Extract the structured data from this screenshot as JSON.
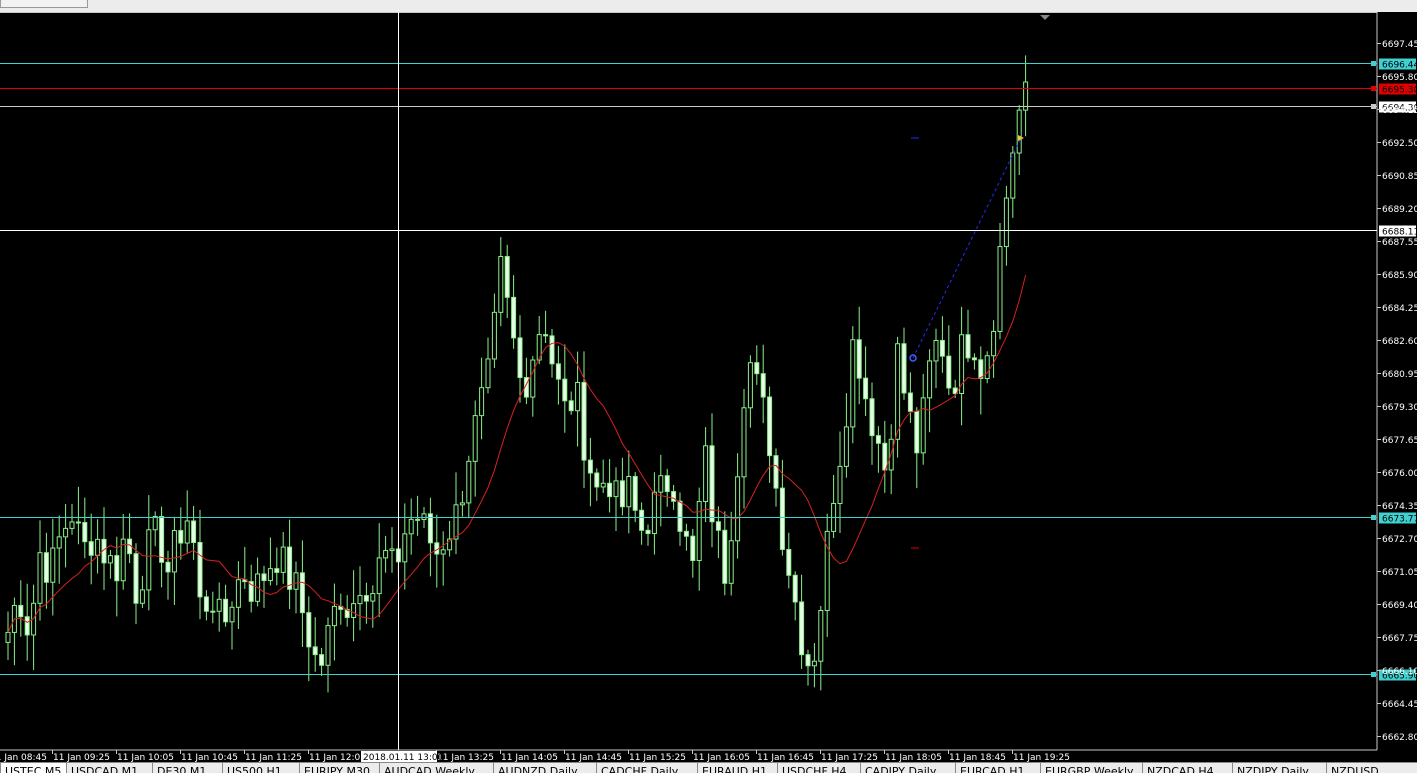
{
  "window": {
    "title_strip": ""
  },
  "colors": {
    "background": "#000000",
    "bull": "#8BF08B",
    "bull_body": "#E8FFE8",
    "ma": "#D82020",
    "hline": "#40D0D0",
    "red_line": "#E00000",
    "crosshair": "#FFFFFF"
  },
  "chart_data": {
    "type": "candlestick",
    "symbol": "USTEC,M5",
    "ylim": [
      6662.8,
      6698.5
    ],
    "y_ticks": [
      "6697.45",
      "6695.80",
      "6694.15",
      "6692.50",
      "6690.85",
      "6689.20",
      "6687.55",
      "6685.90",
      "6684.25",
      "6682.60",
      "6680.95",
      "6679.30",
      "6677.65",
      "6676.00",
      "6674.35",
      "6672.70",
      "6671.05",
      "6669.40",
      "6667.75",
      "6666.10",
      "6664.45",
      "6662.80"
    ],
    "x_ticks": [
      "11 Jan 08:45",
      "11 Jan 09:25",
      "11 Jan 10:05",
      "11 Jan 10:45",
      "11 Jan 11:25",
      "11 Jan 12:05",
      "11 Jan 13:25",
      "11 Jan 14:05",
      "11 Jan 14:45",
      "11 Jan 15:25",
      "11 Jan 16:05",
      "11 Jan 16:45",
      "11 Jan 17:25",
      "11 Jan 18:05",
      "11 Jan 18:45",
      "11 Jan 19:25"
    ],
    "crosshair": {
      "price": "6688.11",
      "time": "2018.01.11 13:00"
    },
    "horizontal_lines": [
      {
        "price": 6696.44,
        "label": "6696.44",
        "color": "#40D0D0",
        "label_bg": "#40D0D0"
      },
      {
        "price": 6695.2,
        "label": "6695.30",
        "color": "#E00000",
        "label_bg": "#E00000"
      },
      {
        "price": 6694.3,
        "label": "6694.30",
        "color": "#C8C8C8",
        "label_bg": "#FFFFFF"
      },
      {
        "price": 6673.77,
        "label": "6673.77",
        "color": "#40D0D0",
        "label_bg": "#40D0D0"
      },
      {
        "price": 6665.9,
        "label": "6665.90",
        "color": "#40D0D0",
        "label_bg": "#40D0D0"
      }
    ],
    "close_path": [
      6668,
      6670,
      6668,
      6672,
      6671,
      6673,
      6674,
      6672,
      6673,
      6672,
      6671,
      6673,
      6670,
      6672,
      6673,
      6671,
      6673,
      6674,
      6669,
      6670,
      6668,
      6670,
      6671,
      6670,
      6671,
      6672,
      6671,
      6670,
      6668,
      6666,
      6668,
      6670,
      6669,
      6671,
      6670,
      6672,
      6671,
      6673,
      6674,
      6673,
      6672,
      6673,
      6674,
      6677,
      6679,
      6681,
      6686,
      6683,
      6680,
      6682,
      6684,
      6681,
      6679,
      6680,
      6677,
      6675,
      6676,
      6674,
      6675,
      6673,
      6674,
      6675,
      6676,
      6673,
      6671,
      6677,
      6673,
      6671,
      6676,
      6682,
      6680,
      6678,
      6674,
      6671,
      6668,
      6666,
      6670,
      6675,
      6678,
      6683,
      6680,
      6678,
      6676,
      6682,
      6679,
      6677,
      6681,
      6683,
      6680,
      6682,
      6683,
      6681,
      6684,
      6689,
      6693,
      6695.5
    ]
  },
  "tabs": [
    "USTEC,M5",
    "USDCAD,M1",
    "DE30,M1",
    "US500,H1",
    "EURJPY,M30",
    "AUDCAD,Weekly",
    "AUDNZD,Daily",
    "CADCHF,Daily",
    "EURAUD,H1",
    "USDCHF,H4",
    "CADJPY,Daily",
    "EURCAD,H1",
    "EURGBP,Weekly",
    "NZDCAD,H4",
    "NZDJPY,Daily",
    "NZDUSD"
  ]
}
